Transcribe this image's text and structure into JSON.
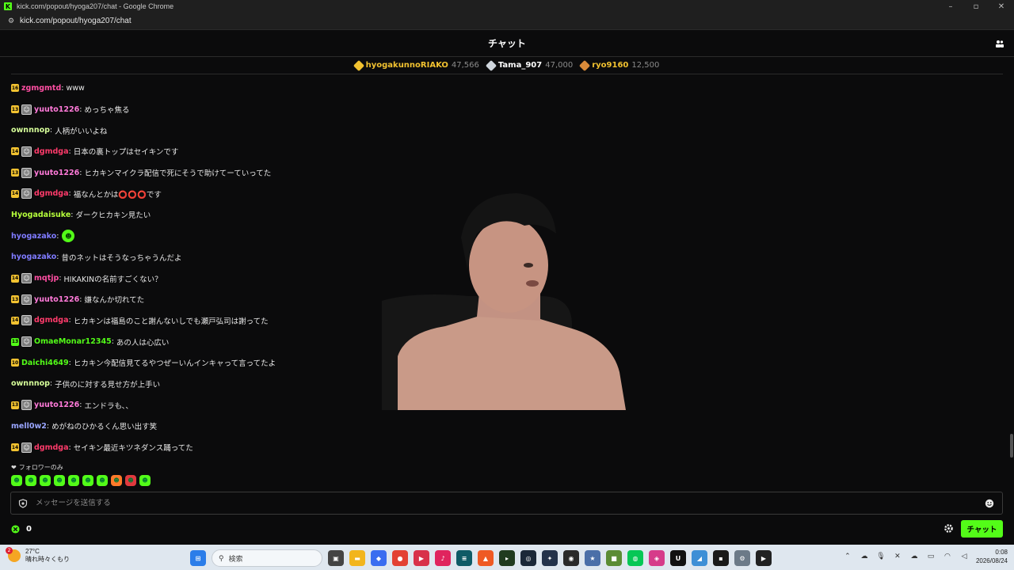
{
  "window": {
    "title": "kick.com/popout/hyoga207/chat - Google Chrome",
    "url": "kick.com/popout/hyoga207/chat"
  },
  "chat": {
    "title": "チャット",
    "leaderboard": [
      {
        "name": "hyogakunnoRIAKO",
        "value": "47,566",
        "color": "#f2c230",
        "name_color": "#f2c230"
      },
      {
        "name": "Tama_907",
        "value": "47,000",
        "color": "#cfd6dd",
        "name_color": "#ffffff"
      },
      {
        "name": "ryo9160",
        "value": "12,500",
        "color": "#d98a3a",
        "name_color": "#f2c230"
      }
    ],
    "messages": [
      {
        "badge": "16",
        "badge_style": "gold",
        "avatar": false,
        "user": "zgmgmtd",
        "color": "#ff4fa3",
        "text": "www"
      },
      {
        "badge": "13",
        "badge_style": "gold",
        "avatar": true,
        "user": "yuuto1226",
        "color": "#ff7ad9",
        "text": "めっちゃ焦る"
      },
      {
        "badge": "",
        "badge_style": "",
        "avatar": false,
        "user": "ownnnop",
        "color": "#d7ff9a",
        "text": "人柄がいいよね"
      },
      {
        "badge": "14",
        "badge_style": "gold",
        "avatar": true,
        "user": "dgmdga",
        "color": "#ff3b6b",
        "text": "日本の裏トップはセイキンです"
      },
      {
        "badge": "13",
        "badge_style": "gold",
        "avatar": true,
        "user": "yuuto1226",
        "color": "#ff7ad9",
        "text": "ヒカキンマイクラ配信で死にそうで助けてーていってた"
      },
      {
        "badge": "14",
        "badge_style": "gold",
        "avatar": true,
        "user": "dgmdga",
        "color": "#ff3b6b",
        "text": "福なんとかは⭕⭕⭕です"
      },
      {
        "badge": "",
        "badge_style": "",
        "avatar": false,
        "user": "Hyogadaisuke",
        "color": "#b6ff3b",
        "text": "ダークヒカキン見たい"
      },
      {
        "badge": "",
        "badge_style": "",
        "avatar": false,
        "user": "hyogazako",
        "color": "#7f7bff",
        "text": "",
        "emote": true
      },
      {
        "badge": "",
        "badge_style": "",
        "avatar": false,
        "user": "hyogazako",
        "color": "#7f7bff",
        "text": "昔のネットはそうなっちゃうんだよ"
      },
      {
        "badge": "14",
        "badge_style": "gold",
        "avatar": true,
        "user": "mqtjp",
        "color": "#ff4fa3",
        "text": "HIKAKINの名前すごくない？"
      },
      {
        "badge": "13",
        "badge_style": "gold",
        "avatar": true,
        "user": "yuuto1226",
        "color": "#ff7ad9",
        "text": "嫌なんか切れてた"
      },
      {
        "badge": "14",
        "badge_style": "gold",
        "avatar": true,
        "user": "dgmdga",
        "color": "#ff3b6b",
        "text": "ヒカキンは福島のこと謝んないしでも瀬戸弘司は謝ってた"
      },
      {
        "badge": "13",
        "badge_style": "green",
        "avatar": true,
        "user": "OmaeMonar12345",
        "color": "#53fc18",
        "text": "あの人は心広い"
      },
      {
        "badge": "10",
        "badge_style": "gold",
        "avatar": false,
        "user": "Daichi4649",
        "color": "#53fc18",
        "text": "ヒカキン今配信見てるやつぜーいんインキャって言ってたよ"
      },
      {
        "badge": "",
        "badge_style": "",
        "avatar": false,
        "user": "ownnnop",
        "color": "#d7ff9a",
        "text": "子供のに対する見せ方が上手い"
      },
      {
        "badge": "13",
        "badge_style": "gold",
        "avatar": true,
        "user": "yuuto1226",
        "color": "#ff7ad9",
        "text": "エンドラも、、"
      },
      {
        "badge": "",
        "badge_style": "",
        "avatar": false,
        "user": "mell0w2",
        "color": "#9aa6ff",
        "text": "めがねのひかるくん思い出す笑"
      },
      {
        "badge": "14",
        "badge_style": "gold",
        "avatar": true,
        "user": "dgmdga",
        "color": "#ff3b6b",
        "text": "セイキン最近キツネダンス踊ってた"
      }
    ],
    "follower_only": "フォロワーのみ",
    "emote_colors": [
      "#53fc18",
      "#53fc18",
      "#53fc18",
      "#53fc18",
      "#53fc18",
      "#53fc18",
      "#53fc18",
      "#ff7a2a",
      "#e0393e",
      "#53fc18"
    ],
    "input_placeholder": "メッセージを送信する",
    "points": "0",
    "send_label": "チャット"
  },
  "taskbar": {
    "badge": "2",
    "temperature": "27°C",
    "weather": "晴れ時々くもり",
    "search_label": "検索",
    "time": "0:08",
    "date": "2026/08/24"
  }
}
